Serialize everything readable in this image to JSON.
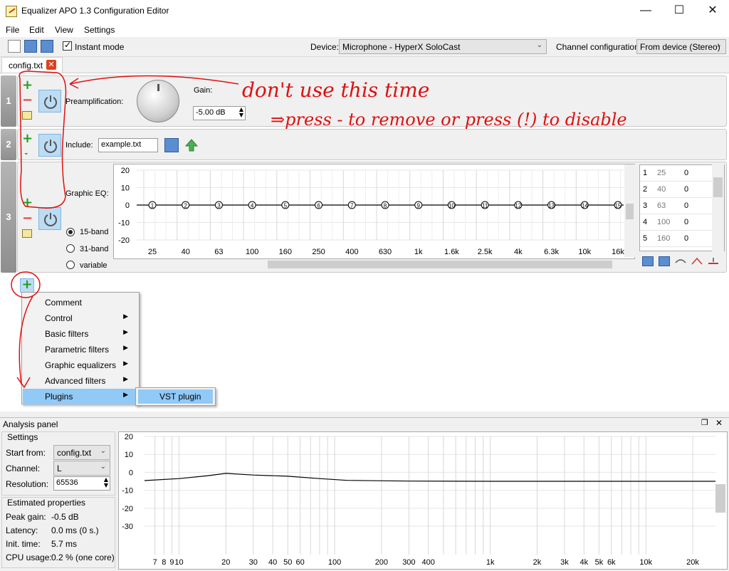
{
  "window": {
    "title": "Equalizer APO 1.3 Configuration Editor"
  },
  "menu": [
    "File",
    "Edit",
    "View",
    "Settings"
  ],
  "toolbar": {
    "instant_mode_label": "Instant mode",
    "instant_mode_checked": true,
    "device_label": "Device:",
    "device_value": "Microphone - HyperX SoloCast",
    "channel_label": "Channel configuration:",
    "channel_value": "From device (Stereo)"
  },
  "tab": {
    "label": "config.txt"
  },
  "rows": [
    {
      "num": "1",
      "label": "Preamplification:",
      "gain_label": "Gain:",
      "gain_value": "-5.00 dB"
    },
    {
      "num": "2",
      "label": "Include:",
      "file_value": "example.txt"
    },
    {
      "num": "3",
      "label": "Graphic EQ:",
      "band_options": [
        "15-band",
        "31-band",
        "variable"
      ],
      "selected_band": "15-band"
    }
  ],
  "eq_graph": {
    "y_ticks": [
      "20",
      "10",
      "0",
      "-10",
      "-20"
    ],
    "x_ticks": [
      "25",
      "40",
      "63",
      "100",
      "160",
      "250",
      "400",
      "630",
      "1k",
      "1.6k",
      "2.5k",
      "4k",
      "6.3k",
      "10k",
      "16k"
    ],
    "bands": [
      "1",
      "2",
      "3",
      "4",
      "5",
      "6",
      "7",
      "8",
      "9",
      "10",
      "11",
      "12",
      "13",
      "14",
      "15"
    ]
  },
  "eq_table": [
    {
      "idx": "1",
      "freq": "25",
      "gain": "0"
    },
    {
      "idx": "2",
      "freq": "40",
      "gain": "0"
    },
    {
      "idx": "3",
      "freq": "63",
      "gain": "0"
    },
    {
      "idx": "4",
      "freq": "100",
      "gain": "0"
    },
    {
      "idx": "5",
      "freq": "160",
      "gain": "0"
    }
  ],
  "context_menu": {
    "items": [
      {
        "label": "Comment",
        "has_sub": false
      },
      {
        "label": "Control",
        "has_sub": true
      },
      {
        "label": "Basic filters",
        "has_sub": true
      },
      {
        "label": "Parametric filters",
        "has_sub": true
      },
      {
        "label": "Graphic equalizers",
        "has_sub": true
      },
      {
        "label": "Advanced filters",
        "has_sub": true
      },
      {
        "label": "Plugins",
        "has_sub": true
      }
    ],
    "highlighted": "Plugins",
    "submenu": [
      "VST plugin"
    ]
  },
  "analysis": {
    "title": "Analysis panel",
    "settings_title": "Settings",
    "start_from_label": "Start from:",
    "start_from_value": "config.txt",
    "channel_label": "Channel:",
    "channel_value": "L",
    "resolution_label": "Resolution:",
    "resolution_value": "65536",
    "estimated_title": "Estimated properties",
    "peak_label": "Peak gain:",
    "peak_value": "-0.5 dB",
    "latency_label": "Latency:",
    "latency_value": "0.0 ms (0 s.)",
    "init_label": "Init. time:",
    "init_value": "5.7 ms",
    "cpu_label": "CPU usage:",
    "cpu_value": "0.2 % (one core)",
    "y_ticks": [
      "20",
      "10",
      "0",
      "-10",
      "-20",
      "-30"
    ],
    "x_ticks": [
      "7",
      "8",
      "9",
      "10",
      "20",
      "30",
      "40",
      "50",
      "60",
      "100",
      "200",
      "300",
      "400",
      "1k",
      "2k",
      "3k",
      "4k",
      "5k",
      "6k",
      "10k",
      "20k"
    ]
  },
  "annotations": {
    "line1": "don't use this time",
    "line2": "⇒press - to remove or press (!) to disable"
  },
  "colors": {
    "accent": "#91c9f7",
    "power_bg": "#bcdcf4",
    "annotation": "#e01010",
    "add": "#1e9e1e",
    "remove": "#e04040"
  }
}
